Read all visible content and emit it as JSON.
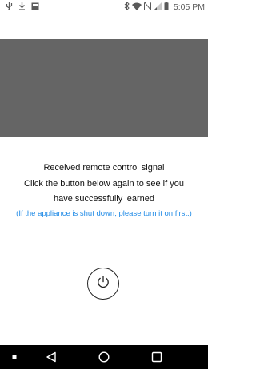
{
  "status_bar": {
    "time": "5:05 PM",
    "left_icons": [
      "usb-icon",
      "download-icon",
      "image-icon"
    ],
    "right_icons": [
      "bluetooth-icon",
      "wifi-icon",
      "no-sim-icon",
      "signal-icon",
      "battery-icon"
    ]
  },
  "message": {
    "line1": "Received remote control signal",
    "line2": "Click the button below again to see if you",
    "line3": "have successfully learned"
  },
  "note": {
    "text": "(If the appliance is shut down, please turn it on first.)",
    "color": "#1f8ae6"
  },
  "power_button": {
    "icon": "power-icon"
  },
  "nav_bar": {
    "items": [
      "menu-dot-icon",
      "back-icon",
      "home-icon",
      "recents-icon"
    ]
  },
  "colors": {
    "panel": "#656565",
    "nav_bar": "#000000"
  }
}
